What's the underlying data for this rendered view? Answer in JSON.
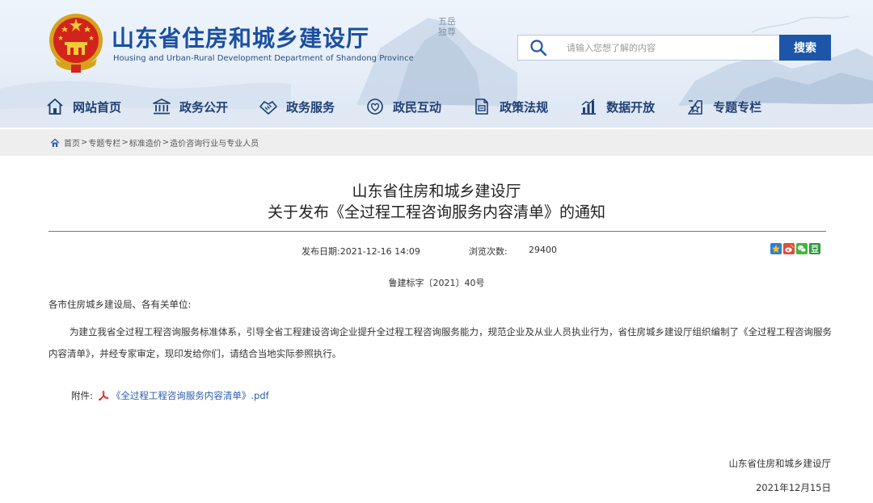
{
  "header": {
    "site_title": "山东省住房和城乡建设厅",
    "site_subtitle": "Housing and Urban-Rural Development Department of Shandong Province",
    "calligraphy": "五岳独尊",
    "emblem_icon": "national-emblem-icon",
    "search": {
      "placeholder": "请输入您想了解的内容",
      "value": "",
      "button_label": "搜索"
    },
    "colors": {
      "brand_blue": "#1a4fa0",
      "search_button": "#1d55a8",
      "nav_text": "#1f3f75"
    }
  },
  "nav": {
    "items": [
      {
        "label": "网站首页",
        "icon": "home-icon"
      },
      {
        "label": "政务公开",
        "icon": "government-building-icon"
      },
      {
        "label": "政务服务",
        "icon": "handshake-icon"
      },
      {
        "label": "政民互动",
        "icon": "heart-chat-icon"
      },
      {
        "label": "政策法规",
        "icon": "document-icon"
      },
      {
        "label": "数据开放",
        "icon": "bar-chart-icon"
      },
      {
        "label": "专题专栏",
        "icon": "star-folder-icon"
      }
    ]
  },
  "breadcrumb": {
    "items": [
      "首页",
      "专题专栏",
      "标准造价",
      "造价咨询行业与专业人员"
    ],
    "separator": ">"
  },
  "article": {
    "title_line1": "山东省住房和城乡建设厅",
    "title_line2": "关于发布《全过程工程咨询服务内容清单》的通知",
    "publish_label": "发布日期:",
    "publish_date": "2021-12-16 14:09",
    "views_label": "浏览次数:",
    "views": "29400",
    "share_icons": [
      "qzone-icon",
      "weibo-icon",
      "wechat-icon",
      "douban-icon"
    ],
    "doc_number": "鲁建标字〔2021〕40号",
    "salutation": "各市住房城乡建设局、各有关单位:",
    "paragraph": "为建立我省全过程工程咨询服务标准体系，引导全省工程建设咨询企业提升全过程工程咨询服务能力，规范企业及从业人员执业行为，省住房城乡建设厅组织编制了《全过程工程咨询服务内容清单》，并经专家审定，现印发给你们，请结合当地实际参照执行。",
    "attachment_label": "附件:",
    "attachment_link": "《全过程工程咨询服务内容清单》.pdf",
    "signature": "山东省住房和城乡建设厅",
    "sign_date": "2021年12月15日"
  }
}
